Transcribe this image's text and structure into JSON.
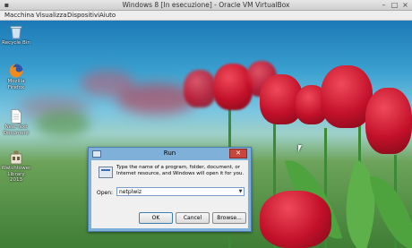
{
  "window": {
    "title": "Windows 8 [In esecuzione] - Oracle VM VirtualBox",
    "controls": [
      "minimize-icon",
      "maximize-icon",
      "close-icon"
    ]
  },
  "menu": {
    "items": [
      {
        "label": "Macchina"
      },
      {
        "label": "Visualizza"
      },
      {
        "label": "Dispositivi"
      },
      {
        "label": "Aiuto"
      }
    ]
  },
  "desktop": {
    "icons": [
      {
        "label": "Recycle Bin",
        "icon": "recycle-bin-icon"
      },
      {
        "label": "Mozilla Firefox",
        "icon": "firefox-icon"
      },
      {
        "label": "New Text Document",
        "icon": "text-document-icon"
      },
      {
        "label": "Watchtower Library 2013",
        "icon": "watchtower-library-icon"
      }
    ]
  },
  "run_dialog": {
    "title": "Run",
    "close_symbol": "✕",
    "description": "Type the name of a program, folder, document, or Internet resource, and Windows will open it for you.",
    "open_label": "Open:",
    "open_value": "netplwiz",
    "ok_label": "OK",
    "cancel_label": "Cancel",
    "browse_label": "Browse..."
  }
}
